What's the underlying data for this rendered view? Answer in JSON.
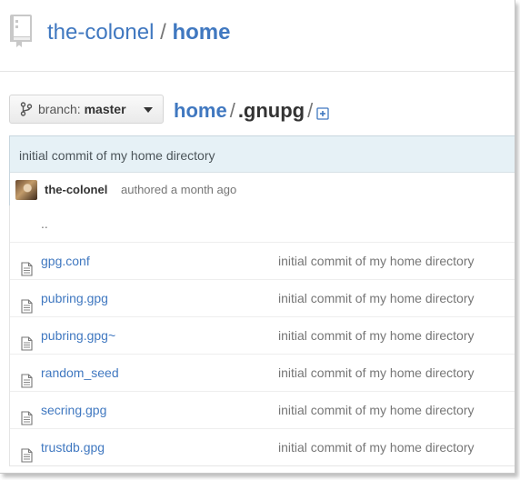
{
  "repo": {
    "owner": "the-colonel",
    "separator": "/",
    "name": "home"
  },
  "branch": {
    "label": "branch:",
    "name": "master"
  },
  "breadcrumb": {
    "root": "home",
    "separator": "/",
    "current": ".gnupg",
    "trailing_separator": "/"
  },
  "latest_commit": {
    "message": "initial commit of my home directory",
    "author": "the-colonel",
    "when": "authored a month ago"
  },
  "files": {
    "updir": "..",
    "rows": [
      {
        "name": "gpg.conf",
        "message": "initial commit of my home directory"
      },
      {
        "name": "pubring.gpg",
        "message": "initial commit of my home directory"
      },
      {
        "name": "pubring.gpg~",
        "message": "initial commit of my home directory"
      },
      {
        "name": "random_seed",
        "message": "initial commit of my home directory"
      },
      {
        "name": "secring.gpg",
        "message": "initial commit of my home directory"
      },
      {
        "name": "trustdb.gpg",
        "message": "initial commit of my home directory"
      }
    ]
  },
  "icons": {
    "repo": "repo-book-icon",
    "branch": "git-branch-icon",
    "add_file": "add-file-icon",
    "file": "file-text-icon"
  },
  "colors": {
    "link": "#4078c0",
    "commit_bar": "#e6f1f6",
    "muted": "#767676"
  }
}
